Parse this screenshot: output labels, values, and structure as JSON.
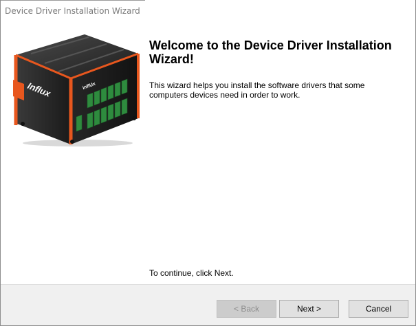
{
  "window": {
    "title": "Device Driver Installation Wizard"
  },
  "welcome": {
    "heading": "Welcome to the Device Driver Installation Wizard!",
    "description": "This wizard helps you install the software drivers that some computers devices need in order to work.",
    "continue_hint": "To continue, click Next."
  },
  "product_image": {
    "brand_label": "Influx",
    "small_label": "inflUx"
  },
  "buttons": {
    "back_label": "< Back",
    "next_label": "Next >",
    "cancel_label": "Cancel"
  },
  "colors": {
    "brand_orange": "#e8571e",
    "device_body": "#2b2b2b",
    "terminal_green": "#2e8b3e",
    "footer_bg": "#f0f0f0"
  }
}
